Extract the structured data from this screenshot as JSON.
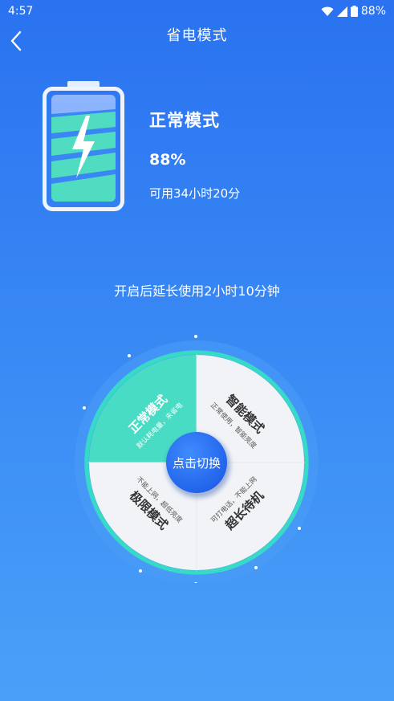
{
  "status_bar": {
    "time": "4:57",
    "battery_pct": "88%"
  },
  "header": {
    "title": "省电模式"
  },
  "current": {
    "mode_name": "正常模式",
    "battery_pct": "88%",
    "remaining": "可用34小时20分"
  },
  "extend_note": "开启后延长使用2小时10分钟",
  "modes": [
    {
      "title": "正常模式",
      "desc": "默认耗电量，未省电",
      "selected": true
    },
    {
      "title": "智能模式",
      "desc": "正常使用，智能亮度",
      "selected": false
    },
    {
      "title": "超长待机",
      "desc": "可打电话，不能上网",
      "selected": false
    },
    {
      "title": "极限模式",
      "desc": "不能上网，超低亮度",
      "selected": false
    }
  ],
  "switch_button": "点击切换",
  "colors": {
    "selected_segment": "#49dcc4",
    "segment": "#f1f3f6",
    "ring": "#36dbc6",
    "center": "#2668ee",
    "accent": "#48e5cb"
  }
}
